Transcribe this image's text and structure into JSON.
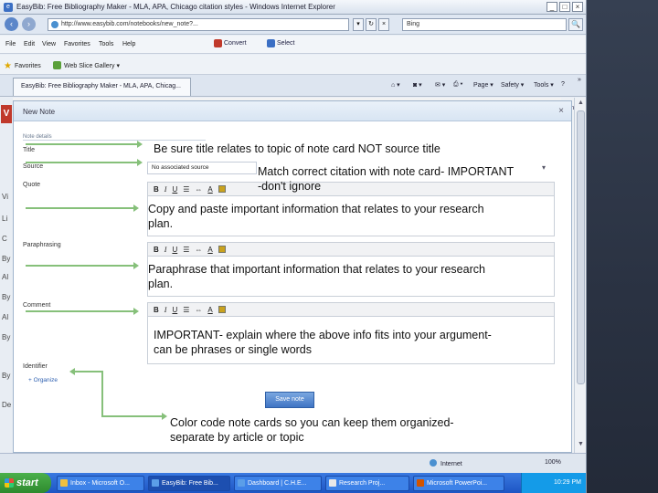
{
  "window": {
    "title": "EasyBib: Free Bibliography Maker - MLA, APA, Chicago citation styles - Windows Internet Explorer",
    "icon": "ie-icon",
    "controls": [
      "_",
      "□",
      "×"
    ]
  },
  "address": {
    "url": "http://www.easybib.com/notebooks/new_note?...",
    "search_text": "Bing",
    "search_icon": "🔍"
  },
  "menu": [
    "File",
    "Edit",
    "View",
    "Favorites",
    "Tools",
    "Help"
  ],
  "toolbar_links": {
    "convert": "Convert",
    "select": "Select"
  },
  "favorites": {
    "label": "Favorites",
    "item": "Web Slice Gallery ▾"
  },
  "tab": {
    "label": "EasyBib: Free Bibliography Maker - MLA, APA, Chicag..."
  },
  "command_bar": {
    "page": "Page ▾",
    "safety": "Safety ▾",
    "tools": "Tools ▾",
    "help": "?",
    "more": "»"
  },
  "page_left_letters": [
    "Vi",
    "Li",
    "C",
    "By",
    "Al",
    "By",
    "Al",
    "By",
    "By",
    "De"
  ],
  "page_right_letters": [
    "com",
    "TO",
    "CE",
    "8X"
  ],
  "modal": {
    "title": "New Note",
    "close": "×",
    "section": "Note details",
    "labels": {
      "title": "Title",
      "source": "Source",
      "quote": "Quote",
      "paraphrasing": "Paraphrasing",
      "comment": "Comment",
      "identifier": "Identifier"
    },
    "source_value": "No associated source",
    "identifier_value": "+ Organize",
    "editor_buttons": {
      "bold": "B",
      "italic": "I",
      "underline": "U",
      "list": "☰",
      "link": "⇔",
      "font_color": "A"
    },
    "save_label": "Save note"
  },
  "annotations": {
    "title": "Be sure title relates to topic of note card NOT source title",
    "source_line1": "Match correct citation with note card- IMPORTANT",
    "source_line2": "-don't ignore",
    "quote_line1": "Copy and paste important information that relates to your research",
    "quote_line2": "plan.",
    "paraphrase_line1": "Paraphrase that important information that relates to your research",
    "paraphrase_line2": "plan.",
    "comment_line1": "IMPORTANT- explain where the above info fits into your argument-",
    "comment_line2": "can be phrases or single words",
    "identifier_line1": "Color code note cards so you can keep them organized-",
    "identifier_line2": "separate by article or topic"
  },
  "status": {
    "zone": "Internet",
    "zoom": "100%"
  },
  "taskbar": {
    "start": "start",
    "items": [
      "Inbox - Microsoft O...",
      "EasyBib: Free Bib...",
      "Dashboard | C.H.E...",
      "Research Proj...",
      "Microsoft PowerPoi..."
    ],
    "clock": "10:29 PM"
  },
  "colors": {
    "annotation_arrow": "#86c07a",
    "save_button": "#3f74c4",
    "taskbar": "#1d55c4"
  }
}
